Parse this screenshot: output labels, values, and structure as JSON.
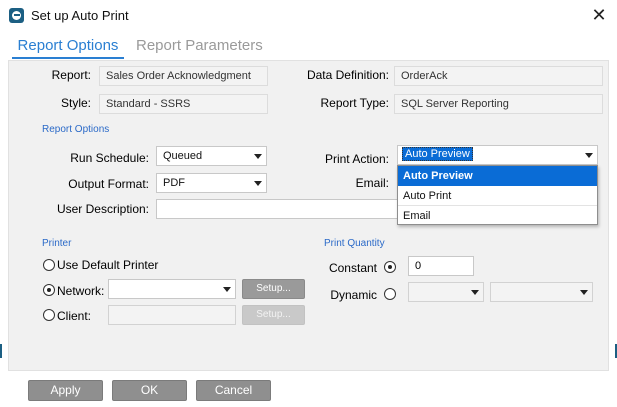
{
  "window": {
    "title": "Set up Auto Print",
    "close_glyph": "✕"
  },
  "tabs": [
    {
      "label": "Report Options",
      "active": true
    },
    {
      "label": "Report Parameters",
      "active": false
    }
  ],
  "report": {
    "report_label": "Report:",
    "report_value": "Sales Order Acknowledgment",
    "style_label": "Style:",
    "style_value": "Standard - SSRS",
    "data_def_label": "Data Definition:",
    "data_def_value": "OrderAck",
    "report_type_label": "Report Type:",
    "report_type_value": "SQL Server Reporting"
  },
  "report_options": {
    "section_title": "Report Options",
    "run_schedule_label": "Run Schedule:",
    "run_schedule_value": "Queued",
    "output_format_label": "Output Format:",
    "output_format_value": "PDF",
    "user_description_label": "User Description:",
    "user_description_value": "",
    "print_action_label": "Print Action:",
    "print_action_value": "Auto Preview",
    "email_label": "Email:",
    "print_action_options": [
      "Auto Preview",
      "Auto Print",
      "Email"
    ],
    "print_action_selected_index": 0
  },
  "printer": {
    "section_title": "Printer",
    "use_default_label": "Use Default Printer",
    "network_label": "Network:",
    "network_value": "",
    "client_label": "Client:",
    "client_value": "",
    "setup_label": "Setup...",
    "selected": "network"
  },
  "print_quantity": {
    "section_title": "Print Quantity",
    "constant_label": "Constant",
    "constant_value": "0",
    "dynamic_label": "Dynamic",
    "selected": "constant"
  },
  "footer": {
    "apply_label": "Apply",
    "ok_label": "OK",
    "cancel_label": "Cancel"
  },
  "colors": {
    "accent": "#2a7fd2",
    "selection": "#0a6cd6",
    "button": "#8f8f8f",
    "section_text": "#2b6ac8"
  }
}
